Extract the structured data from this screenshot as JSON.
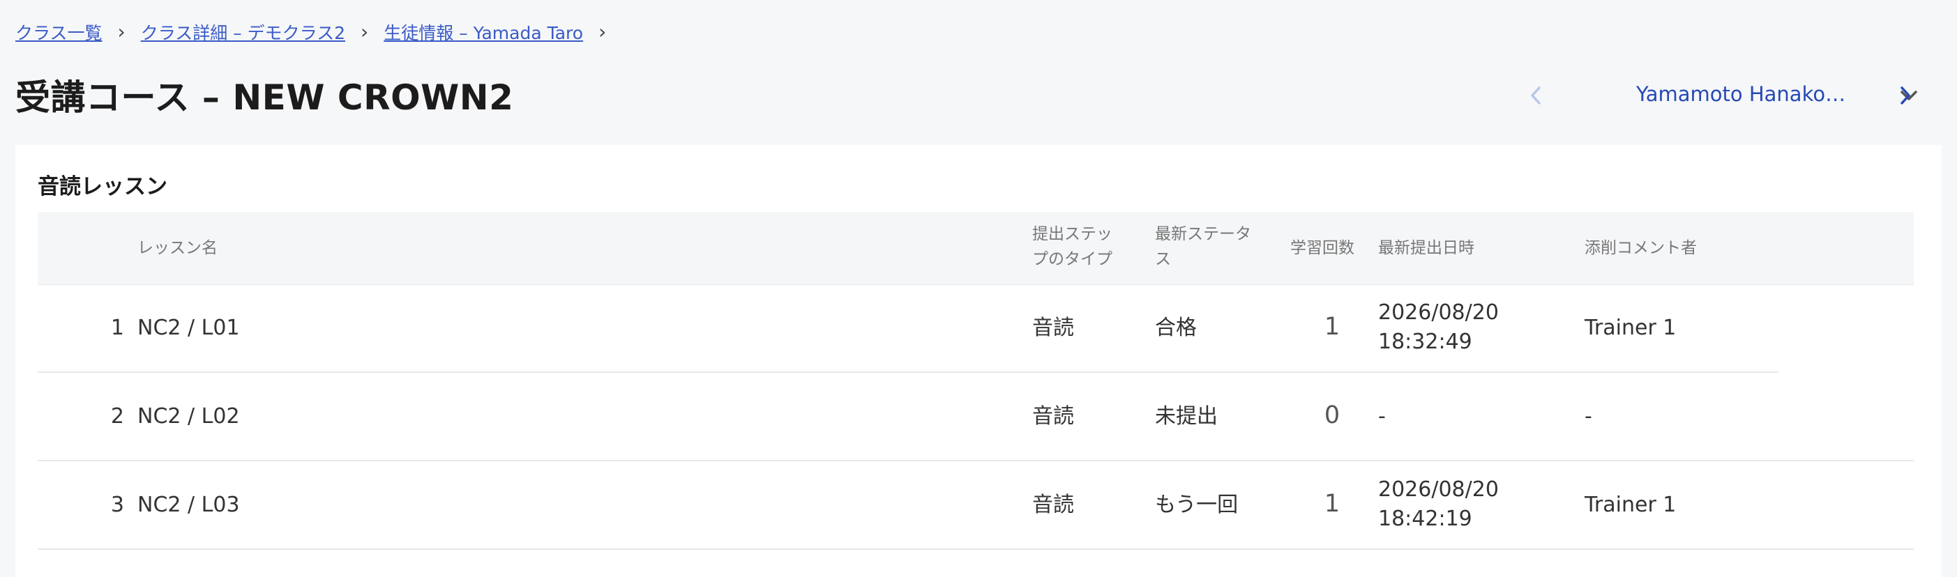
{
  "breadcrumb": {
    "items": [
      {
        "label": "クラス一覧"
      },
      {
        "label": "クラス詳細 – デモクラス2"
      },
      {
        "label": "生徒情報 – Yamada Taro"
      }
    ],
    "separator": "›"
  },
  "page": {
    "title": "受講コース – NEW CROWN2"
  },
  "student_nav": {
    "selected_student": "Yamamoto Hanako…"
  },
  "section": {
    "title": "音読レッスン"
  },
  "table": {
    "headers": {
      "lesson_name": "レッスン名",
      "step_type_line1": "提出ステッ",
      "step_type_line2": "プのタイプ",
      "status_line1": "最新ステータ",
      "status_line2": "ス",
      "study_count": "学習回数",
      "submitted_at": "最新提出日時",
      "commenter": "添削コメント者"
    },
    "rows": [
      {
        "no": "1",
        "lesson": "NC2 / L01",
        "step_type": "音読",
        "status": "合格",
        "count": "1",
        "date": "2026/08/20",
        "time": "18:32:49",
        "commenter": "Trainer 1"
      },
      {
        "no": "2",
        "lesson": "NC2 / L02",
        "step_type": "音読",
        "status": "未提出",
        "count": "0",
        "date": "-",
        "time": "",
        "commenter": "-"
      },
      {
        "no": "3",
        "lesson": "NC2 / L03",
        "step_type": "音読",
        "status": "もう一回",
        "count": "1",
        "date": "2026/08/20",
        "time": "18:42:19",
        "commenter": "Trainer 1"
      }
    ]
  },
  "colors": {
    "link": "#3a5bc7",
    "accent": "#2649b5",
    "nav_disabled": "#b9c6ee"
  }
}
